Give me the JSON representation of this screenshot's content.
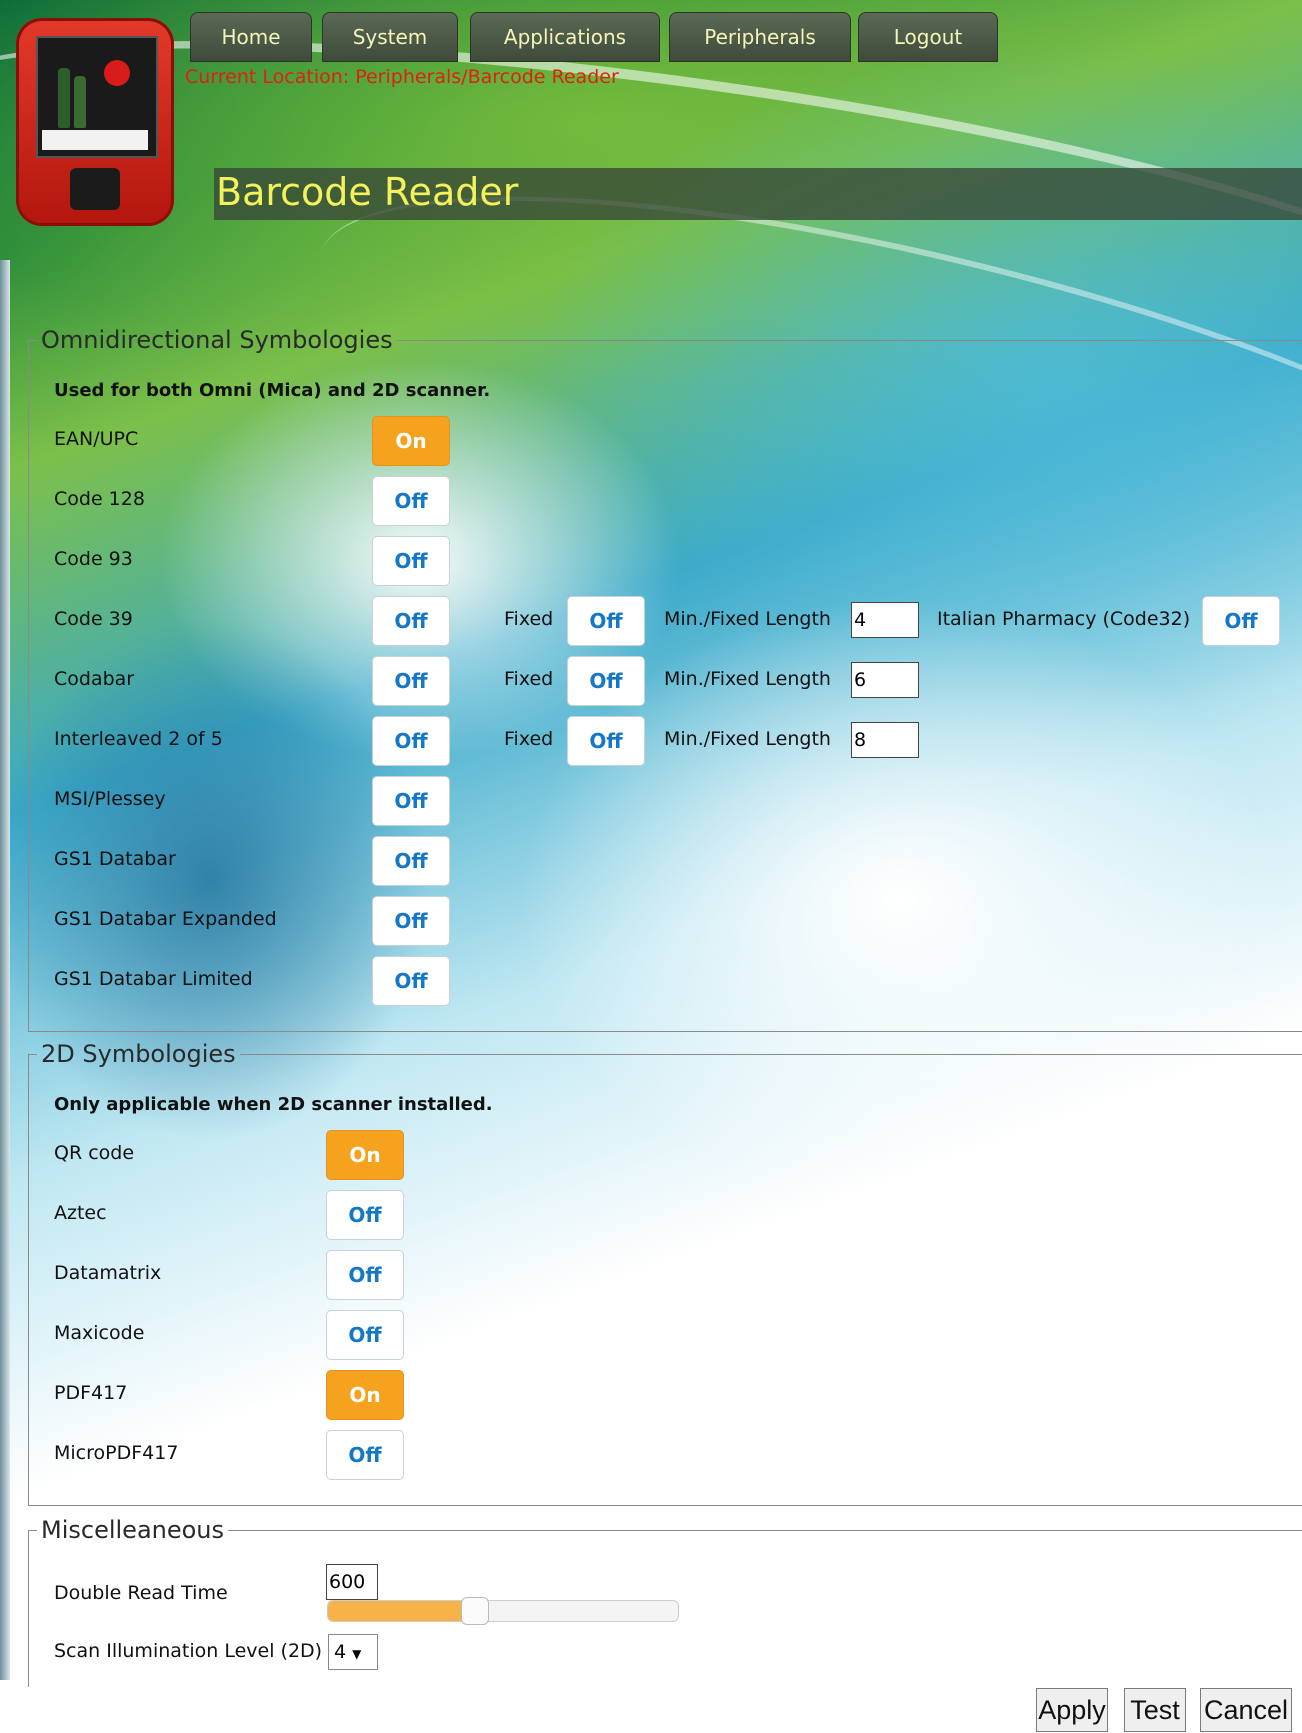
{
  "nav": {
    "items": [
      "Home",
      "System",
      "Applications",
      "Peripherals",
      "Logout"
    ]
  },
  "location": "Current Location: Peripherals/Barcode Reader",
  "page_title": "Barcode Reader",
  "omni": {
    "legend": "Omnidirectional Symbologies",
    "note": "Used for both Omni (Mica) and 2D scanner.",
    "rows": [
      {
        "label": "EAN/UPC",
        "state": "On"
      },
      {
        "label": "Code 128",
        "state": "Off"
      },
      {
        "label": "Code 93",
        "state": "Off"
      },
      {
        "label": "Code 39",
        "state": "Off",
        "fixed_label": "Fixed",
        "fixed_state": "Off",
        "length_label": "Min./Fixed Length",
        "length": "4",
        "extra_label": "Italian Pharmacy (Code32)",
        "extra_state": "Off"
      },
      {
        "label": "Codabar",
        "state": "Off",
        "fixed_label": "Fixed",
        "fixed_state": "Off",
        "length_label": "Min./Fixed Length",
        "length": "6"
      },
      {
        "label": "Interleaved 2 of 5",
        "state": "Off",
        "fixed_label": "Fixed",
        "fixed_state": "Off",
        "length_label": "Min./Fixed Length",
        "length": "8"
      },
      {
        "label": "MSI/Plessey",
        "state": "Off"
      },
      {
        "label": "GS1 Databar",
        "state": "Off"
      },
      {
        "label": "GS1 Databar Expanded",
        "state": "Off"
      },
      {
        "label": "GS1 Databar Limited",
        "state": "Off"
      }
    ]
  },
  "twod": {
    "legend": "2D Symbologies",
    "note": "Only applicable when 2D scanner installed.",
    "rows": [
      {
        "label": "QR code",
        "state": "On"
      },
      {
        "label": "Aztec",
        "state": "Off"
      },
      {
        "label": "Datamatrix",
        "state": "Off"
      },
      {
        "label": "Maxicode",
        "state": "Off"
      },
      {
        "label": "PDF417",
        "state": "On"
      },
      {
        "label": "MicroPDF417",
        "state": "Off"
      }
    ]
  },
  "misc": {
    "legend": "Miscelleaneous",
    "double_read_label": "Double Read Time",
    "double_read_value": "600",
    "slider_fraction": 0.42,
    "illumination_label": "Scan Illumination Level (2D)",
    "illumination_value": "4"
  },
  "actions": {
    "apply": "Apply",
    "test": "Test",
    "cancel": "Cancel"
  },
  "colors": {
    "on": "#f5a31f",
    "off_text": "#1577c7",
    "nav_text": "#f4f3b8",
    "title_text": "#f4f15c",
    "location_text": "#e02010"
  }
}
